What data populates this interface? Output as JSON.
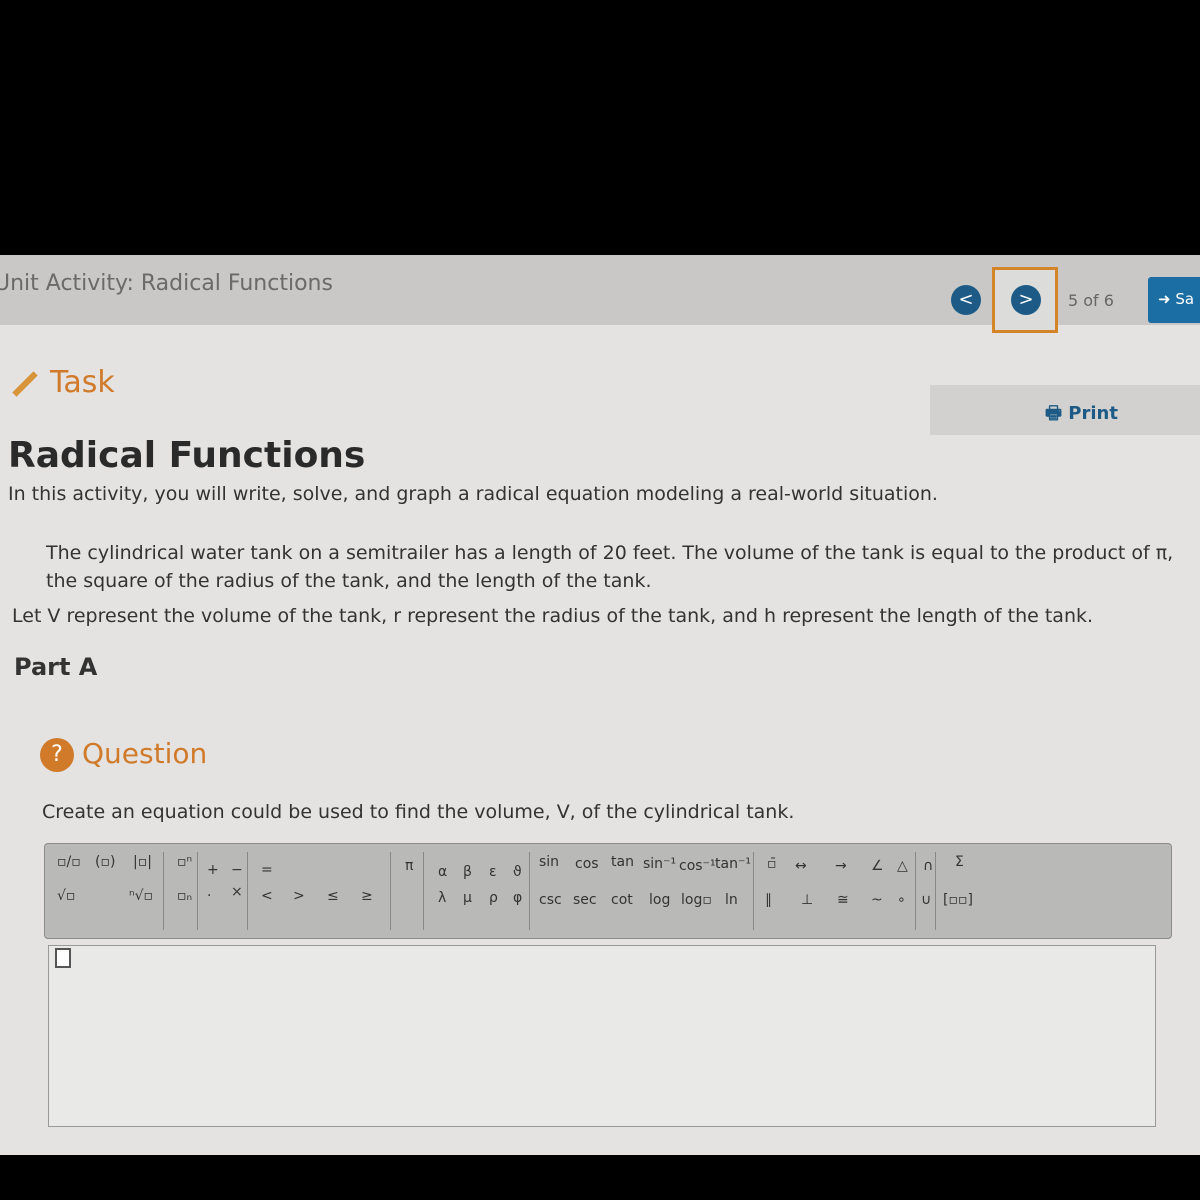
{
  "header": {
    "unit_title": "Unit Activity: Radical Functions",
    "prev_label": "<",
    "next_label": ">",
    "page_count": "5 of 6",
    "save_label": "Sa"
  },
  "task": {
    "label": "Task",
    "print_label": "Print"
  },
  "content": {
    "title": "Radical Functions",
    "intro": "In this activity, you will write, solve, and graph a radical equation modeling a real-world situation.",
    "paragraph1": "The cylindrical water tank on a semitrailer has a length of 20 feet. The volume of the tank is equal to the product of π, the square of the radius of the tank, and the length of the tank.",
    "paragraph2": "Let V represent the volume of the tank, r represent the radius of the tank, and h represent the length of the tank.",
    "part": "Part A"
  },
  "question": {
    "label": "Question",
    "icon": "?",
    "text": "Create an equation could be used to find the volume, V, of the cylindrical tank."
  },
  "toolbar": {
    "buttons": [
      "▫/▫",
      "(▫)",
      "|▫|",
      "▫ⁿ",
      "+",
      "−",
      "=",
      "π",
      "α",
      "β",
      "ε",
      "ϑ",
      "sin",
      "cos",
      "tan",
      "sin⁻¹",
      "cos⁻¹",
      "tan⁻¹",
      "▫̄",
      "↔",
      "→",
      "∠",
      "△",
      "∩",
      "Σ",
      "√▫",
      "ⁿ√▫",
      "▫ₙ",
      "·",
      "×",
      "<",
      ">",
      "≤",
      "≥",
      "λ",
      "μ",
      "ρ",
      "φ",
      "csc",
      "sec",
      "cot",
      "log",
      "log▫",
      "ln",
      "∥",
      "⊥",
      "≅",
      "~",
      "∘",
      "∪",
      "[▫▫]"
    ]
  }
}
